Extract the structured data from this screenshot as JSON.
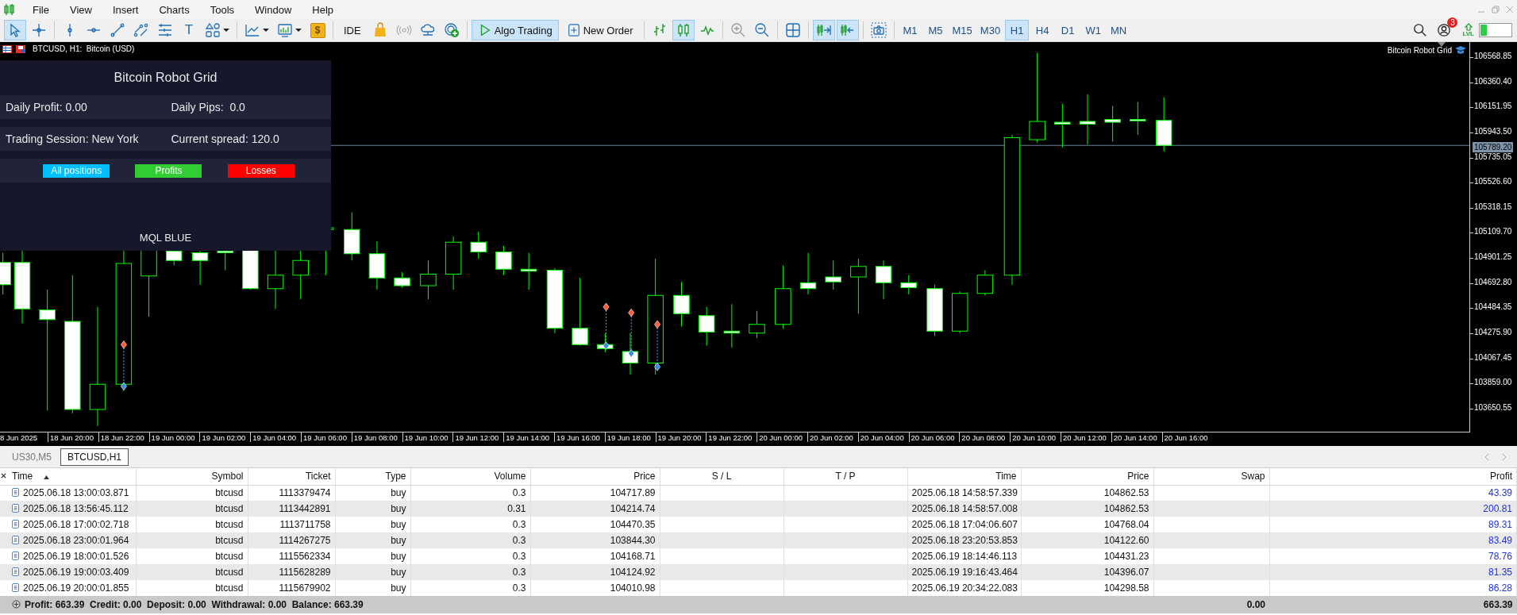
{
  "menu": {
    "items": [
      "File",
      "View",
      "Insert",
      "Charts",
      "Tools",
      "Window",
      "Help"
    ]
  },
  "toolbar": {
    "groups": [
      [
        {
          "kind": "cursor",
          "active": true,
          "dropdown": false
        },
        {
          "kind": "crosshair",
          "active": false,
          "dropdown": false
        }
      ],
      [
        {
          "kind": "vline",
          "active": false,
          "dropdown": false
        },
        {
          "kind": "hline",
          "active": false,
          "dropdown": false
        },
        {
          "kind": "trendline",
          "active": false,
          "dropdown": false
        },
        {
          "kind": "channel",
          "active": false,
          "dropdown": false
        },
        {
          "kind": "levels",
          "active": false,
          "dropdown": false
        },
        {
          "kind": "text",
          "label": "T",
          "active": false,
          "dropdown": false
        },
        {
          "kind": "shapes",
          "active": false,
          "dropdown": true
        }
      ],
      [
        {
          "kind": "indicators",
          "active": false,
          "dropdown": true
        },
        {
          "kind": "templates",
          "active": false,
          "dropdown": true
        },
        {
          "kind": "dollar",
          "label": "$",
          "active": false,
          "dropdown": false
        }
      ],
      [
        {
          "kind": "ide",
          "label": "IDE",
          "active": false,
          "dropdown": false
        },
        {
          "kind": "market",
          "active": false,
          "dropdown": false
        },
        {
          "kind": "signals",
          "active": false,
          "dropdown": false
        },
        {
          "kind": "vps",
          "active": false,
          "dropdown": false
        },
        {
          "kind": "add",
          "active": false,
          "dropdown": false
        }
      ],
      [
        {
          "kind": "algo",
          "label": "Algo Trading",
          "active": true,
          "dropdown": false
        },
        {
          "kind": "order",
          "label": "New Order",
          "active": false,
          "dropdown": false
        }
      ],
      [
        {
          "kind": "bars",
          "active": false,
          "dropdown": false
        },
        {
          "kind": "candles",
          "active": true,
          "dropdown": false
        },
        {
          "kind": "line",
          "active": false,
          "dropdown": false
        }
      ],
      [
        {
          "kind": "zoomin",
          "active": false,
          "dropdown": false
        },
        {
          "kind": "zoomout",
          "active": false,
          "dropdown": false
        }
      ],
      [
        {
          "kind": "tile",
          "active": false,
          "dropdown": false
        }
      ],
      [
        {
          "kind": "scroll",
          "active": true,
          "dropdown": false
        },
        {
          "kind": "shift",
          "active": true,
          "dropdown": false
        }
      ],
      [
        {
          "kind": "screenshot",
          "active": false,
          "dropdown": false
        }
      ]
    ],
    "timeframes": [
      {
        "label": "M1",
        "selected": false
      },
      {
        "label": "M5",
        "selected": false
      },
      {
        "label": "M15",
        "selected": false
      },
      {
        "label": "M30",
        "selected": false
      },
      {
        "label": "H1",
        "selected": true
      },
      {
        "label": "H4",
        "selected": false
      },
      {
        "label": "D1",
        "selected": false
      },
      {
        "label": "W1",
        "selected": false
      },
      {
        "label": "MN",
        "selected": false
      }
    ],
    "notification_badge": "3",
    "level_label": "LVL"
  },
  "chart": {
    "header": "BTCUSD, H1:  Bitcoin (USD)",
    "indicator_name": "Bitcoin Robot Grid",
    "current_price": "105789.20",
    "price_labels": [
      "106568.85",
      "106360.40",
      "106151.95",
      "105943.50",
      "105735.05",
      "105526.60",
      "105318.15",
      "105109.70",
      "104901.25",
      "104692.80",
      "104484.35",
      "104275.90",
      "104067.45",
      "103859.00",
      "103650.55"
    ],
    "time_labels": [
      "8 Jun 2025",
      "18 Jun 20:00",
      "18 Jun 22:00",
      "19 Jun 00:00",
      "19 Jun 02:00",
      "19 Jun 04:00",
      "19 Jun 06:00",
      "19 Jun 08:00",
      "19 Jun 10:00",
      "19 Jun 12:00",
      "19 Jun 14:00",
      "19 Jun 16:00",
      "19 Jun 18:00",
      "19 Jun 20:00",
      "19 Jun 22:00",
      "20 Jun 00:00",
      "20 Jun 02:00",
      "20 Jun 04:00",
      "20 Jun 06:00",
      "20 Jun 08:00",
      "20 Jun 10:00",
      "20 Jun 12:00",
      "20 Jun 14:00",
      "20 Jun 16:00"
    ]
  },
  "panel": {
    "title": "Bitcoin Robot Grid",
    "rows": [
      [
        "Daily Profit: 0.00",
        "Daily Pips:  0.0"
      ],
      [
        "Trading Session: New York",
        "Current spread: 120.0"
      ]
    ],
    "buttons": [
      {
        "label": "All positions",
        "color": "#00bfff"
      },
      {
        "label": "Profits",
        "color": "#32cd32"
      },
      {
        "label": "Losses",
        "color": "#ff0000"
      }
    ],
    "footer": "MQL BLUE"
  },
  "tabs": [
    {
      "label": "US30,M5",
      "selected": false
    },
    {
      "label": "BTCUSD,H1",
      "selected": true
    }
  ],
  "table": {
    "columns": [
      {
        "label": "Time",
        "sorted": true
      },
      {
        "label": "Symbol",
        "sorted": false
      },
      {
        "label": "Ticket",
        "sorted": false
      },
      {
        "label": "Type",
        "sorted": false
      },
      {
        "label": "Volume",
        "sorted": false
      },
      {
        "label": "Price",
        "sorted": false
      },
      {
        "label": "S / L",
        "sorted": false
      },
      {
        "label": "T / P",
        "sorted": false
      },
      {
        "label": "Time",
        "sorted": false
      },
      {
        "label": "Price",
        "sorted": false
      },
      {
        "label": "Swap",
        "sorted": false
      },
      {
        "label": "Profit",
        "sorted": false
      }
    ],
    "rows": [
      {
        "time": "2025.06.18 13:00:03.871",
        "symbol": "btcusd",
        "ticket": "1113379474",
        "type": "buy",
        "volume": "0.3",
        "price": "104717.89",
        "close_time": "2025.06.18 14:58:57.339",
        "close_price": "104862.53",
        "profit": "43.39"
      },
      {
        "time": "2025.06.18 13:56:45.112",
        "symbol": "btcusd",
        "ticket": "1113442891",
        "type": "buy",
        "volume": "0.31",
        "price": "104214.74",
        "close_time": "2025.06.18 14:58:57.008",
        "close_price": "104862.53",
        "profit": "200.81"
      },
      {
        "time": "2025.06.18 17:00:02.718",
        "symbol": "btcusd",
        "ticket": "1113711758",
        "type": "buy",
        "volume": "0.3",
        "price": "104470.35",
        "close_time": "2025.06.18 17:04:06.607",
        "close_price": "104768.04",
        "profit": "89.31"
      },
      {
        "time": "2025.06.18 23:00:01.964",
        "symbol": "btcusd",
        "ticket": "1114267275",
        "type": "buy",
        "volume": "0.3",
        "price": "103844.30",
        "close_time": "2025.06.18 23:20:53.853",
        "close_price": "104122.60",
        "profit": "83.49"
      },
      {
        "time": "2025.06.19 18:00:01.526",
        "symbol": "btcusd",
        "ticket": "1115562334",
        "type": "buy",
        "volume": "0.3",
        "price": "104168.71",
        "close_time": "2025.06.19 18:14:46.113",
        "close_price": "104431.23",
        "profit": "78.76"
      },
      {
        "time": "2025.06.19 19:00:03.409",
        "symbol": "btcusd",
        "ticket": "1115628289",
        "type": "buy",
        "volume": "0.3",
        "price": "104124.92",
        "close_time": "2025.06.19 19:16:43.464",
        "close_price": "104396.07",
        "profit": "81.35"
      },
      {
        "time": "2025.06.19 20:00:01.855",
        "symbol": "btcusd",
        "ticket": "1115679902",
        "type": "buy",
        "volume": "0.3",
        "price": "104010.98",
        "close_time": "2025.06.19 20:34:22.083",
        "close_price": "104298.58",
        "profit": "86.28"
      }
    ],
    "summary": "Profit: 663.39  Credit: 0.00  Deposit: 0.00  Withdrawal: 0.00  Balance: 663.39",
    "swap_total": "0.00",
    "profit_total": "663.39"
  }
}
